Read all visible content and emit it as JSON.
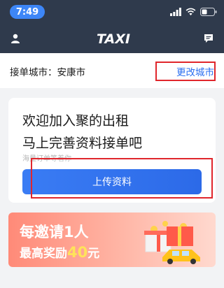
{
  "status_bar": {
    "time": "7:49"
  },
  "nav": {
    "logo_text": "TAXI"
  },
  "city": {
    "label": "接单城市：安康市",
    "change_label": "更改城市"
  },
  "welcome_card": {
    "title_line1": "欢迎加入聚的出租",
    "title_line2": "马上完善资料接单吧",
    "subtitle": "海量订单等着你",
    "upload_label": "上传资料"
  },
  "promo_banner": {
    "line1": "每邀请1人",
    "line2_prefix": "最高奖励",
    "amount": "40",
    "unit": "元"
  },
  "colors": {
    "nav_bg": "#2f3a4c",
    "accent_blue": "#2b6ff0",
    "annotation_red": "#e0262c",
    "banner_orange": "#ff8a78"
  }
}
